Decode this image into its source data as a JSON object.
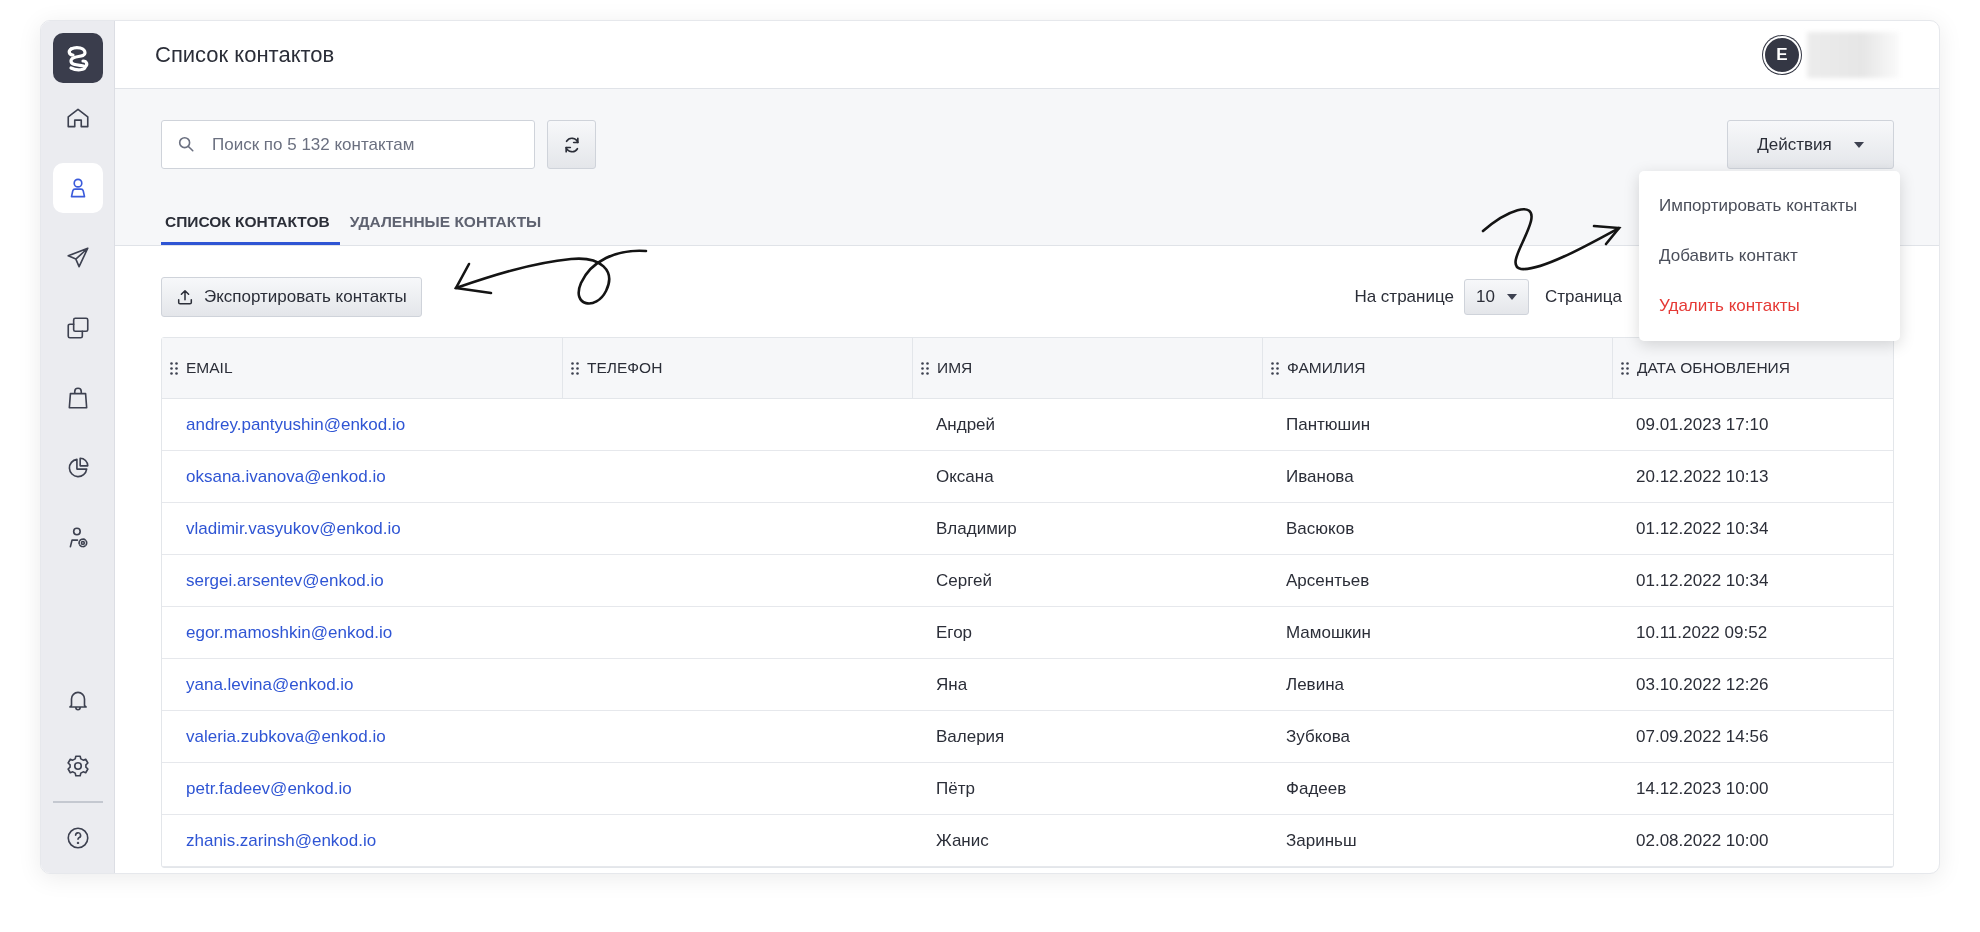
{
  "header": {
    "title": "Список контактов",
    "avatar": "E"
  },
  "sidebar": {
    "items": [
      {
        "selected": false
      },
      {
        "selected": true
      },
      {
        "selected": false
      },
      {
        "selected": false
      },
      {
        "selected": false
      },
      {
        "selected": false
      },
      {
        "selected": false
      }
    ],
    "bottom_items": [
      {
        "selected": false
      },
      {
        "selected": false
      },
      {
        "selected": false
      }
    ]
  },
  "toolbar": {
    "search": {
      "placeholder": "Поиск по 5 132 контактам"
    },
    "actions_button": "Действия"
  },
  "actions_menu": [
    {
      "label": "Импортировать контакты",
      "kind": "normal"
    },
    {
      "label": "Добавить контакт",
      "kind": "normal"
    },
    {
      "label": "Удалить контакты",
      "kind": "danger"
    }
  ],
  "tabs": [
    {
      "label": "СПИСОК КОНТАКТОВ",
      "selected": true
    },
    {
      "label": "УДАЛЕННЫЕ КОНТАКТЫ",
      "selected": false
    }
  ],
  "export_button": "Экспортировать контакты",
  "pagination": {
    "per_page_label": "На странице",
    "per_page_value": "10",
    "page_label": "Страница"
  },
  "table": {
    "columns": [
      "EMAIL",
      "ТЕЛЕФОН",
      "ИМЯ",
      "ФАМИЛИЯ",
      "ДАТА ОБНОВЛЕНИЯ"
    ],
    "rows": [
      {
        "email": "andrey.pantyushin@enkod.io",
        "first_name": "Андрей",
        "last_name": "Пантюшин",
        "updated": "09.01.2023 17:10"
      },
      {
        "email": "oksana.ivanova@enkod.io",
        "first_name": "Оксана",
        "last_name": "Иванова",
        "updated": "20.12.2022 10:13"
      },
      {
        "email": "vladimir.vasyukov@enkod.io",
        "first_name": "Владимир",
        "last_name": "Васюков",
        "updated": "01.12.2022 10:34"
      },
      {
        "email": "sergei.arsentev@enkod.io",
        "first_name": "Сергей",
        "last_name": "Арсентьев",
        "updated": "01.12.2022 10:34"
      },
      {
        "email": "egor.mamoshkin@enkod.io",
        "first_name": "Егор",
        "last_name": "Мамошкин",
        "updated": "10.11.2022 09:52"
      },
      {
        "email": "yana.levina@enkod.io",
        "first_name": "Яна",
        "last_name": "Левина",
        "updated": "03.10.2022 12:26"
      },
      {
        "email": "valeria.zubkova@enkod.io",
        "first_name": "Валерия",
        "last_name": "Зубкова",
        "updated": "07.09.2022 14:56"
      },
      {
        "email": "petr.fadeev@enkod.io",
        "first_name": "Пётр",
        "last_name": "Фадеев",
        "updated": "14.12.2023 10:00"
      },
      {
        "email": "zhanis.zarinsh@enkod.io",
        "first_name": "Жанис",
        "last_name": "Зариньш",
        "updated": "02.08.2022 10:00"
      }
    ]
  }
}
